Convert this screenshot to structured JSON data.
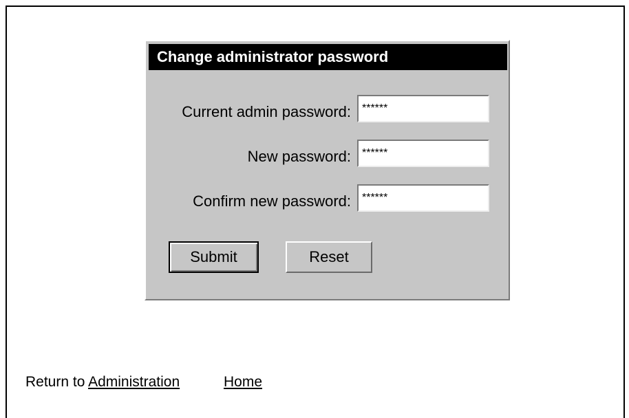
{
  "form": {
    "title": "Change administrator password",
    "fields": [
      {
        "label": "Current admin password:",
        "value": "******"
      },
      {
        "label": "New password:",
        "value": "******"
      },
      {
        "label": "Confirm new password:",
        "value": "******"
      }
    ],
    "submit_label": "Submit",
    "reset_label": "Reset"
  },
  "footer": {
    "prefix": "Return to",
    "administration_link": "Administration",
    "home_link": "Home"
  }
}
